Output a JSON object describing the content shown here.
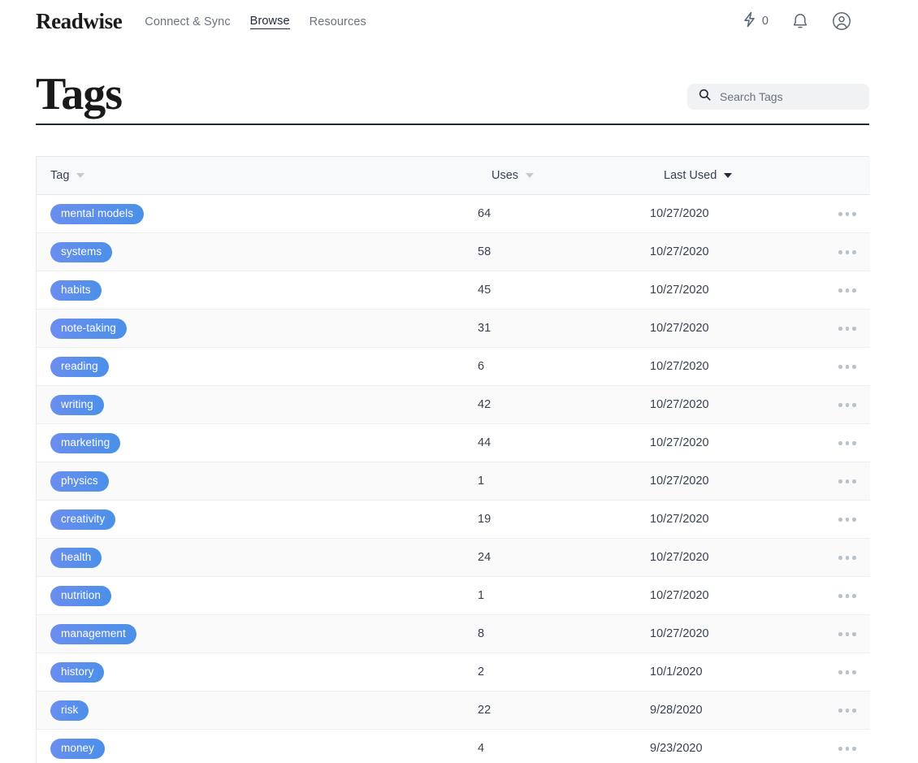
{
  "nav": {
    "brand": "Readwise",
    "links": [
      {
        "label": "Connect & Sync",
        "active": false
      },
      {
        "label": "Browse",
        "active": true
      },
      {
        "label": "Resources",
        "active": false
      }
    ],
    "streak_count": "0",
    "streak_icon": "lightning-bolt-icon",
    "bell_icon": "bell-icon",
    "account_icon": "user-avatar-icon"
  },
  "header": {
    "title": "Tags"
  },
  "search": {
    "placeholder": "Search Tags",
    "value": "",
    "icon": "search-icon"
  },
  "table": {
    "columns": [
      {
        "label": "Tag",
        "sort": "inactive"
      },
      {
        "label": "Uses",
        "sort": "inactive"
      },
      {
        "label": "Last Used",
        "sort": "active"
      },
      {
        "label": "",
        "sort": "none"
      }
    ],
    "row_action_icon": "ellipsis-icon",
    "accent_color": "#5b8def",
    "rows": [
      {
        "tag": "mental models",
        "uses": "64",
        "last_used": "10/27/2020"
      },
      {
        "tag": "systems",
        "uses": "58",
        "last_used": "10/27/2020"
      },
      {
        "tag": "habits",
        "uses": "45",
        "last_used": "10/27/2020"
      },
      {
        "tag": "note-taking",
        "uses": "31",
        "last_used": "10/27/2020"
      },
      {
        "tag": "reading",
        "uses": "6",
        "last_used": "10/27/2020"
      },
      {
        "tag": "writing",
        "uses": "42",
        "last_used": "10/27/2020"
      },
      {
        "tag": "marketing",
        "uses": "44",
        "last_used": "10/27/2020"
      },
      {
        "tag": "physics",
        "uses": "1",
        "last_used": "10/27/2020"
      },
      {
        "tag": "creativity",
        "uses": "19",
        "last_used": "10/27/2020"
      },
      {
        "tag": "health",
        "uses": "24",
        "last_used": "10/27/2020"
      },
      {
        "tag": "nutrition",
        "uses": "1",
        "last_used": "10/27/2020"
      },
      {
        "tag": "management",
        "uses": "8",
        "last_used": "10/27/2020"
      },
      {
        "tag": "history",
        "uses": "2",
        "last_used": "10/1/2020"
      },
      {
        "tag": "risk",
        "uses": "22",
        "last_used": "9/28/2020"
      },
      {
        "tag": "money",
        "uses": "4",
        "last_used": "9/23/2020"
      }
    ]
  }
}
